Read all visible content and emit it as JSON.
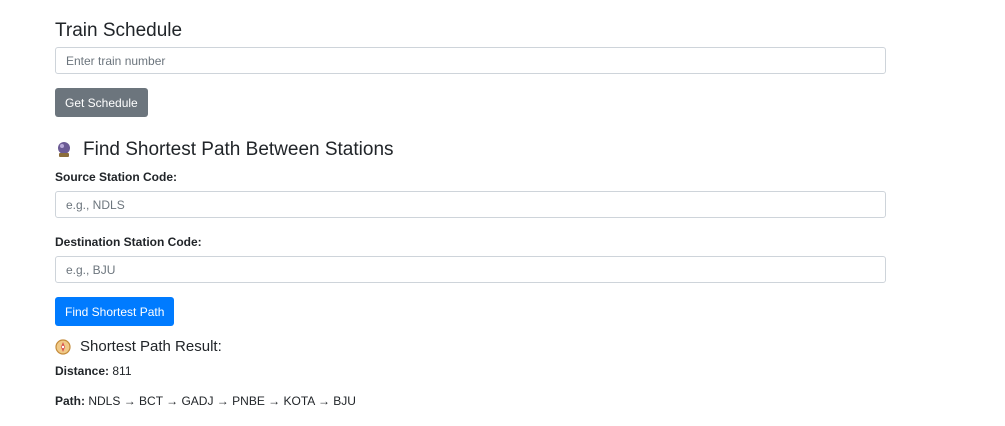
{
  "train_schedule": {
    "title": "Train Schedule",
    "train_number_placeholder": "Enter train number",
    "button_label": "Get Schedule"
  },
  "shortest_path": {
    "title": "Find Shortest Path Between Stations",
    "source_label": "Source Station Code:",
    "source_placeholder": "e.g., NDLS",
    "destination_label": "Destination Station Code:",
    "destination_placeholder": "e.g., BJU",
    "button_label": "Find Shortest Path"
  },
  "result": {
    "title": "Shortest Path Result:",
    "distance_label": "Distance:",
    "distance_value": "811",
    "path_label": "Path:",
    "path_value": "NDLS → BCT → GADJ → PNBE → KOTA → BJU"
  },
  "icons": {
    "section_icon": "crystal-ball-icon",
    "result_icon": "compass-icon"
  }
}
